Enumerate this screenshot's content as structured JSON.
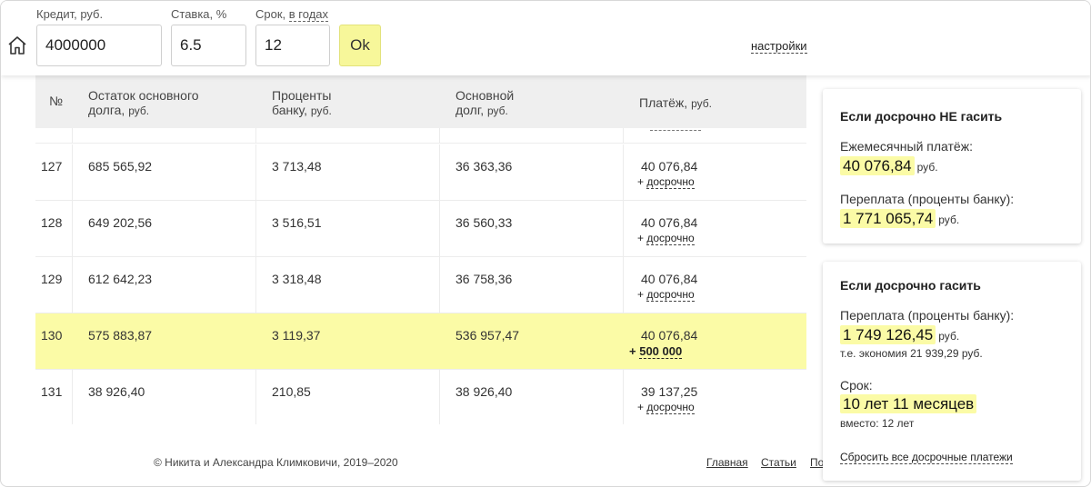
{
  "header": {
    "credit_label": "Кредит, руб.",
    "credit_value": "4000000",
    "rate_label": "Ставка, %",
    "rate_value": "6.5",
    "term_label": "Срок,",
    "term_unit_link": "в годах",
    "term_value": "12",
    "ok_label": "Ok",
    "settings_link": "настройки"
  },
  "table": {
    "headers": {
      "num": "№",
      "balance_line1": "Остаток основного",
      "balance_line2": "долга,",
      "balance_unit": "руб.",
      "interest_line1": "Проценты",
      "interest_line2": "банку,",
      "interest_unit": "руб.",
      "principal_line1": "Основной",
      "principal_line2": "долг,",
      "principal_unit": "руб.",
      "payment": "Платёж,",
      "payment_unit": "руб."
    },
    "rows": [
      {
        "num": "127",
        "balance": "685 565,92",
        "interest": "3 713,48",
        "principal": "36 363,36",
        "payment": "40 076,84",
        "early_prefix": "+",
        "early_link": "досрочно"
      },
      {
        "num": "128",
        "balance": "649 202,56",
        "interest": "3 516,51",
        "principal": "36 560,33",
        "payment": "40 076,84",
        "early_prefix": "+",
        "early_link": "досрочно"
      },
      {
        "num": "129",
        "balance": "612 642,23",
        "interest": "3 318,48",
        "principal": "36 758,36",
        "payment": "40 076,84",
        "early_prefix": "+",
        "early_link": "досрочно"
      },
      {
        "num": "130",
        "balance": "575 883,87",
        "interest": "3 119,37",
        "principal": "536 957,47",
        "payment": "40 076,84",
        "early_prefix": "+",
        "early_link": "500 000"
      },
      {
        "num": "131",
        "balance": "38 926,40",
        "interest": "210,85",
        "principal": "38 926,40",
        "payment": "39 137,25",
        "early_prefix": "+",
        "early_link": "досрочно"
      }
    ]
  },
  "card_no_early": {
    "title": "Если досрочно НЕ гасить",
    "monthly_label": "Ежемесячный платёж:",
    "monthly_value": "40 076,84",
    "monthly_unit": "руб.",
    "overpay_label": "Переплата (проценты банку):",
    "overpay_value": "1 771 065,74",
    "overpay_unit": "руб."
  },
  "card_early": {
    "title": "Если досрочно гасить",
    "overpay_label": "Переплата (проценты банку):",
    "overpay_value": "1 749 126,45",
    "overpay_unit": "руб.",
    "savings_note": "т.е. экономия 21 939,29 руб.",
    "term_label": "Срок:",
    "term_value": "10 лет 11 месяцев",
    "term_note": "вместо: 12 лет",
    "reset_link": "Сбросить все досрочные платежи"
  },
  "footer": {
    "copyright": "© Никита и Александра Климковичи, 2019–2020",
    "link_main": "Главная",
    "link_articles": "Статьи",
    "link_cut": "По"
  },
  "colors": {
    "highlight": "#fbfba6",
    "header_bg": "#efefef",
    "ok_button": "#f7f79a"
  }
}
